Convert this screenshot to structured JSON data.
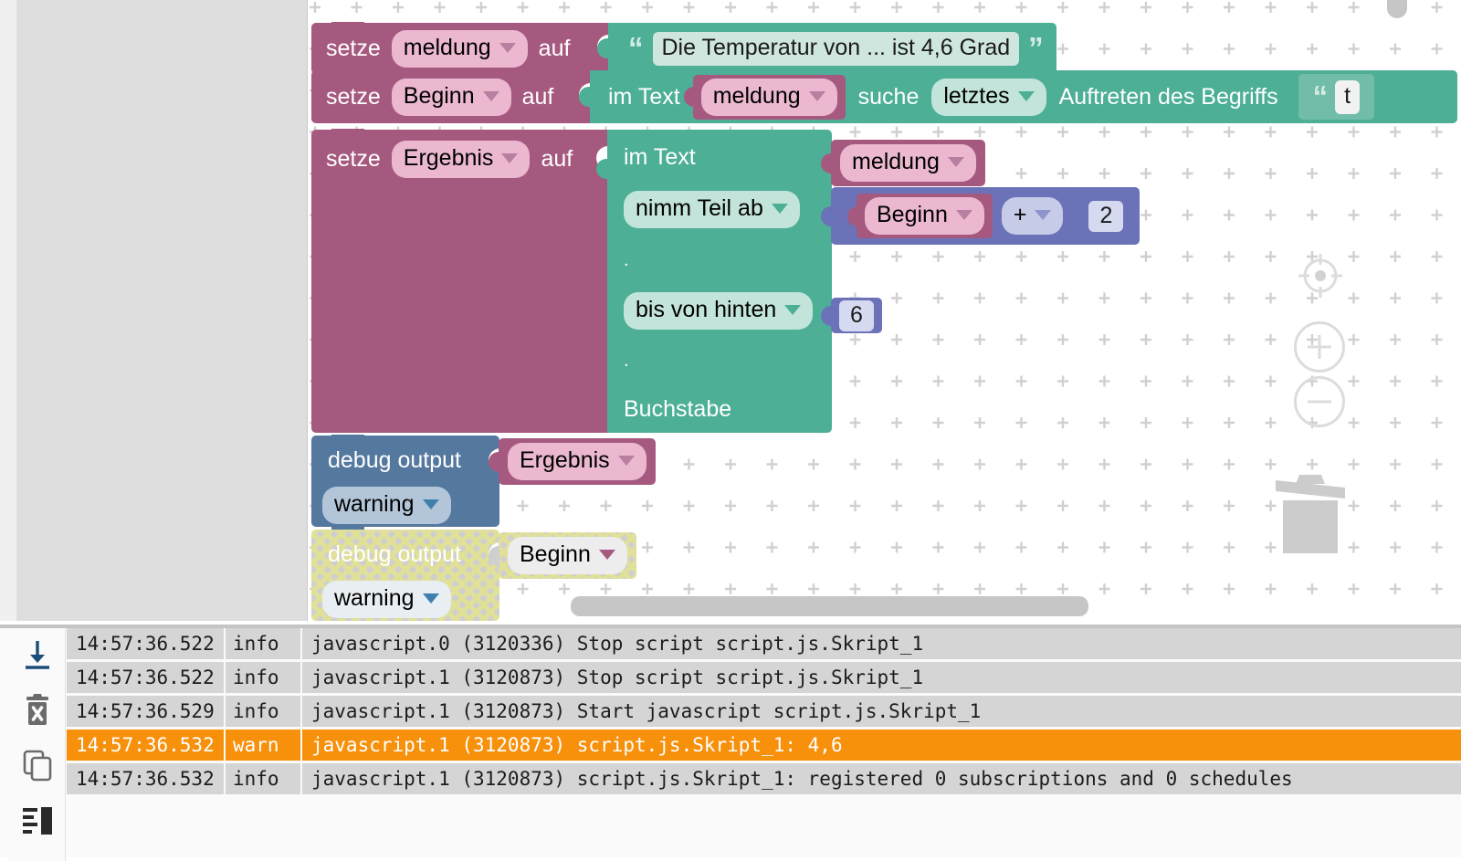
{
  "workspace": {
    "blocks": [
      {
        "id": "set-meldung",
        "kind": "variable-setter",
        "label_set": "setze",
        "variable": "meldung",
        "label_to": "auf",
        "value": {
          "kind": "text-literal",
          "text": "Die Temperatur von ... ist 4,6 Grad",
          "open_quote": "“",
          "close_quote": "”"
        }
      },
      {
        "id": "set-beginn",
        "kind": "variable-setter",
        "label_set": "setze",
        "variable": "Beginn",
        "label_to": "auf",
        "value": {
          "kind": "text-index-of",
          "label_in_text": "im Text",
          "haystack_variable": "meldung",
          "label_search": "suche",
          "direction": "letztes",
          "label_occurrence": "Auftreten des Begriffs",
          "needle_open_quote": "“",
          "needle_text": "t"
        }
      },
      {
        "id": "set-ergebnis",
        "kind": "variable-setter",
        "label_set": "setze",
        "variable": "Ergebnis",
        "label_to": "auf",
        "value": {
          "kind": "text-get-substring",
          "label_in_text": "im Text",
          "source_variable": "meldung",
          "label_take": "nimm Teil ab",
          "start_mode": "nimm Teil ab",
          "start_expression": {
            "kind": "math-arithmetic",
            "left_variable": "Beginn",
            "operator": "+",
            "right_number": "2"
          },
          "dot_1": ".",
          "label_until": "bis von hinten",
          "end_number": "6",
          "dot_2": ".",
          "label_letter": "Buchstabe"
        }
      },
      {
        "id": "debug-ergebnis",
        "kind": "debug-output",
        "label": "debug output",
        "severity": "warning",
        "value_variable": "Ergebnis",
        "disabled": false
      },
      {
        "id": "debug-beginn",
        "kind": "debug-output",
        "label": "debug output",
        "severity": "warning",
        "value_variable": "Beginn",
        "disabled": true
      }
    ],
    "controls": {
      "center_label": "center-on-blocks",
      "zoom_in_label": "+",
      "zoom_out_label": "−",
      "trash_label": "trashcan"
    },
    "colors": {
      "variable": "#a6597f",
      "text": "#4caf96",
      "math": "#6b72b8",
      "debug": "#55789f",
      "grid": "#d2d2d2"
    }
  },
  "log": {
    "toolbar": [
      {
        "name": "scroll-to-bottom",
        "title": "Autoscroll"
      },
      {
        "name": "clear-log",
        "title": "Clear log"
      },
      {
        "name": "copy-log",
        "title": "Copy to clipboard"
      },
      {
        "name": "log-levels",
        "title": "Log level"
      }
    ],
    "columns": [
      "time",
      "severity",
      "message"
    ],
    "rows": [
      {
        "time": "14:57:36.522",
        "severity": "info",
        "message": "javascript.0 (3120336) Stop script script.js.Skript_1"
      },
      {
        "time": "14:57:36.522",
        "severity": "info",
        "message": "javascript.1 (3120873) Stop script script.js.Skript_1"
      },
      {
        "time": "14:57:36.529",
        "severity": "info",
        "message": "javascript.1 (3120873) Start javascript script.js.Skript_1"
      },
      {
        "time": "14:57:36.532",
        "severity": "warn",
        "message": "javascript.1 (3120873) script.js.Skript_1: 4,6"
      },
      {
        "time": "14:57:36.532",
        "severity": "info",
        "message": "javascript.1 (3120873) script.js.Skript_1: registered 0 subscriptions and 0 schedules"
      }
    ],
    "colors": {
      "warn_bg": "#f7900b",
      "row_bg": "#d5d5d5"
    }
  }
}
